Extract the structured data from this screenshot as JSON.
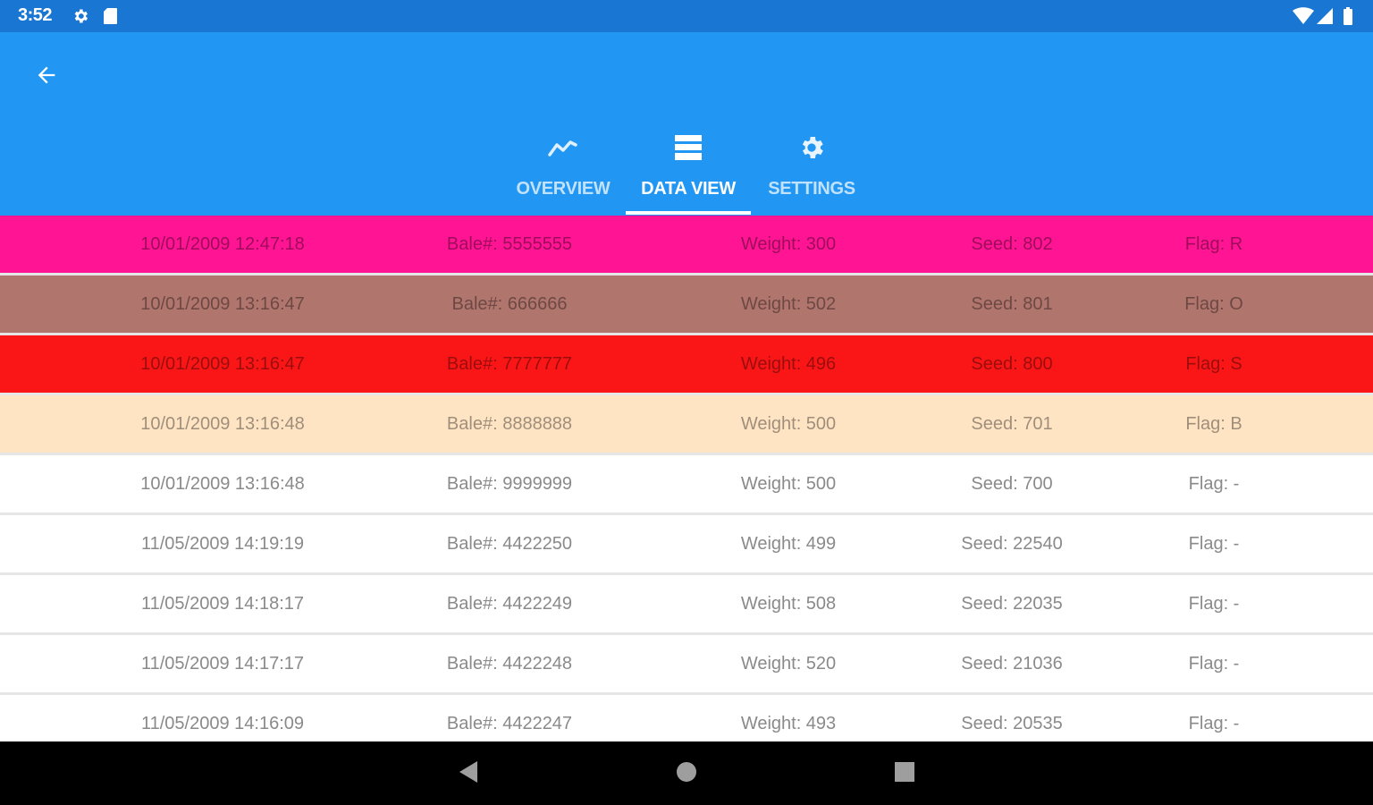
{
  "status_bar": {
    "time": "3:52",
    "left_icons": [
      "gear-icon",
      "sd-card-icon"
    ],
    "right_icons": [
      "wifi-icon",
      "cell-signal-icon",
      "battery-icon"
    ],
    "background": "#1976D2"
  },
  "app_bar": {
    "back_icon": "arrow-left-icon",
    "background": "#2196F3",
    "tabs": [
      {
        "label": "OVERVIEW",
        "icon": "trending-line-icon",
        "active": false
      },
      {
        "label": "DATA VIEW",
        "icon": "list-icon",
        "active": true
      },
      {
        "label": "SETTINGS",
        "icon": "gear-icon",
        "active": false
      }
    ]
  },
  "records": [
    {
      "date": "10/01/2009 12:47:18",
      "bale": "Bale#: 5555555",
      "weight": "Weight: 300",
      "seed": "Seed: 802",
      "flag": "Flag: R",
      "color": "#FF1493"
    },
    {
      "date": "10/01/2009 13:16:47",
      "bale": "Bale#: 666666",
      "weight": "Weight: 502",
      "seed": "Seed: 801",
      "flag": "Flag: O",
      "color": "#B0756D"
    },
    {
      "date": "10/01/2009 13:16:47",
      "bale": "Bale#: 7777777",
      "weight": "Weight: 496",
      "seed": "Seed: 800",
      "flag": "Flag: S",
      "color": "#FA1616"
    },
    {
      "date": "10/01/2009 13:16:48",
      "bale": "Bale#: 8888888",
      "weight": "Weight: 500",
      "seed": "Seed: 701",
      "flag": "Flag: B",
      "color": "#FFE4C4"
    },
    {
      "date": "10/01/2009 13:16:48",
      "bale": "Bale#: 9999999",
      "weight": "Weight: 500",
      "seed": "Seed: 700",
      "flag": "Flag: -",
      "color": "#FFFFFF"
    },
    {
      "date": "11/05/2009 14:19:19",
      "bale": "Bale#: 4422250",
      "weight": "Weight: 499",
      "seed": "Seed: 22540",
      "flag": "Flag: -",
      "color": "#FFFFFF"
    },
    {
      "date": "11/05/2009 14:18:17",
      "bale": "Bale#: 4422249",
      "weight": "Weight: 508",
      "seed": "Seed: 22035",
      "flag": "Flag: -",
      "color": "#FFFFFF"
    },
    {
      "date": "11/05/2009 14:17:17",
      "bale": "Bale#: 4422248",
      "weight": "Weight: 520",
      "seed": "Seed: 21036",
      "flag": "Flag: -",
      "color": "#FFFFFF"
    },
    {
      "date": "11/05/2009 14:16:09",
      "bale": "Bale#: 4422247",
      "weight": "Weight: 493",
      "seed": "Seed: 20535",
      "flag": "Flag: -",
      "color": "#FFFFFF"
    }
  ],
  "nav_bar": {
    "buttons": [
      "back-triangle-icon",
      "home-circle-icon",
      "recents-square-icon"
    ]
  }
}
